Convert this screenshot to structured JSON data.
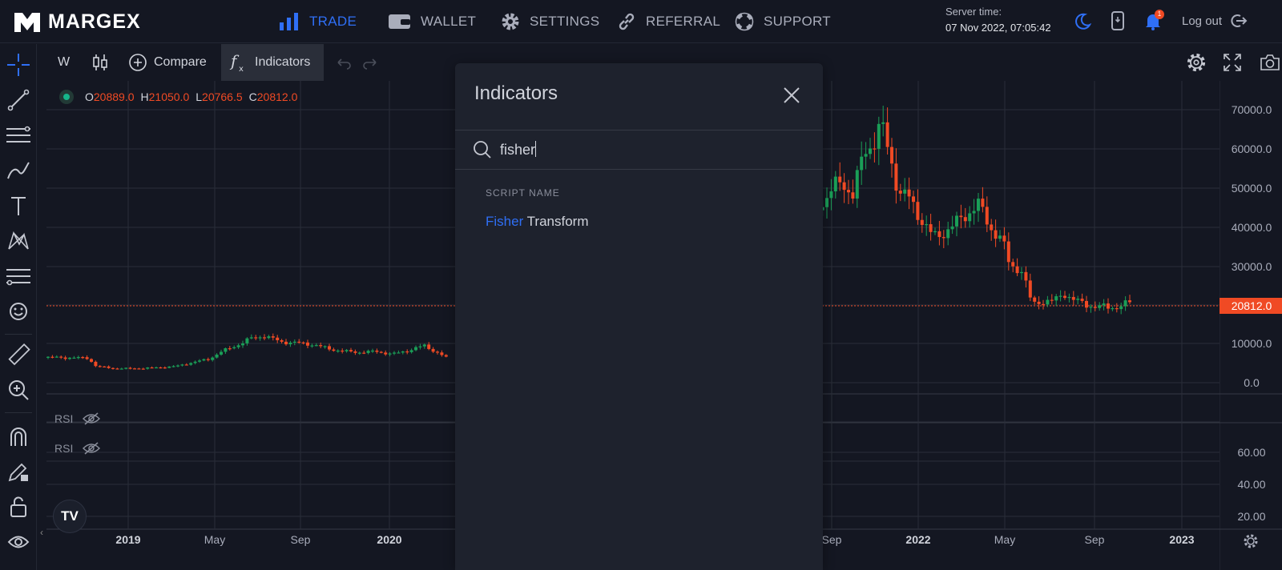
{
  "brand": {
    "name": "MARGEX"
  },
  "nav": [
    {
      "label": "TRADE",
      "icon": "bar-chart-icon",
      "active": true
    },
    {
      "label": "WALLET",
      "icon": "wallet-icon"
    },
    {
      "label": "SETTINGS",
      "icon": "gear-icon"
    },
    {
      "label": "REFERRAL",
      "icon": "link-icon"
    },
    {
      "label": "SUPPORT",
      "icon": "lifebuoy-icon"
    }
  ],
  "server": {
    "label": "Server time:",
    "time": "07 Nov 2022, 07:05:42"
  },
  "notifications": {
    "count": "1"
  },
  "logout_label": "Log out",
  "toolbar": {
    "interval": "W",
    "compare": "Compare",
    "indicators": "Indicators"
  },
  "legend": {
    "o_label": "O",
    "o": "20889.0",
    "h_label": "H",
    "h": "21050.0",
    "l_label": "L",
    "l": "20766.5",
    "c_label": "C",
    "c": "20812.0"
  },
  "rsi_panes": [
    {
      "label": "RSI"
    },
    {
      "label": "RSI"
    }
  ],
  "price_axis": {
    "labels": [
      "70000.0",
      "60000.0",
      "50000.0",
      "40000.0",
      "30000.0",
      "10000.0",
      "0.0"
    ],
    "current": "20812.0",
    "rsi_labels": [
      "60.00",
      "40.00",
      "20.00"
    ]
  },
  "time_axis": [
    "2019",
    "May",
    "Sep",
    "2020",
    "Sep",
    "2022",
    "May",
    "Sep",
    "2023"
  ],
  "colors": {
    "up": "#1a9e57",
    "down": "#f04a24",
    "accent": "#2f6ff5",
    "bg": "#141722"
  },
  "modal": {
    "title": "Indicators",
    "search_value": "fisher",
    "section_heading": "SCRIPT NAME",
    "results": [
      {
        "match": "Fisher",
        "rest": " Transform"
      }
    ]
  },
  "tv_logo": "TV"
}
